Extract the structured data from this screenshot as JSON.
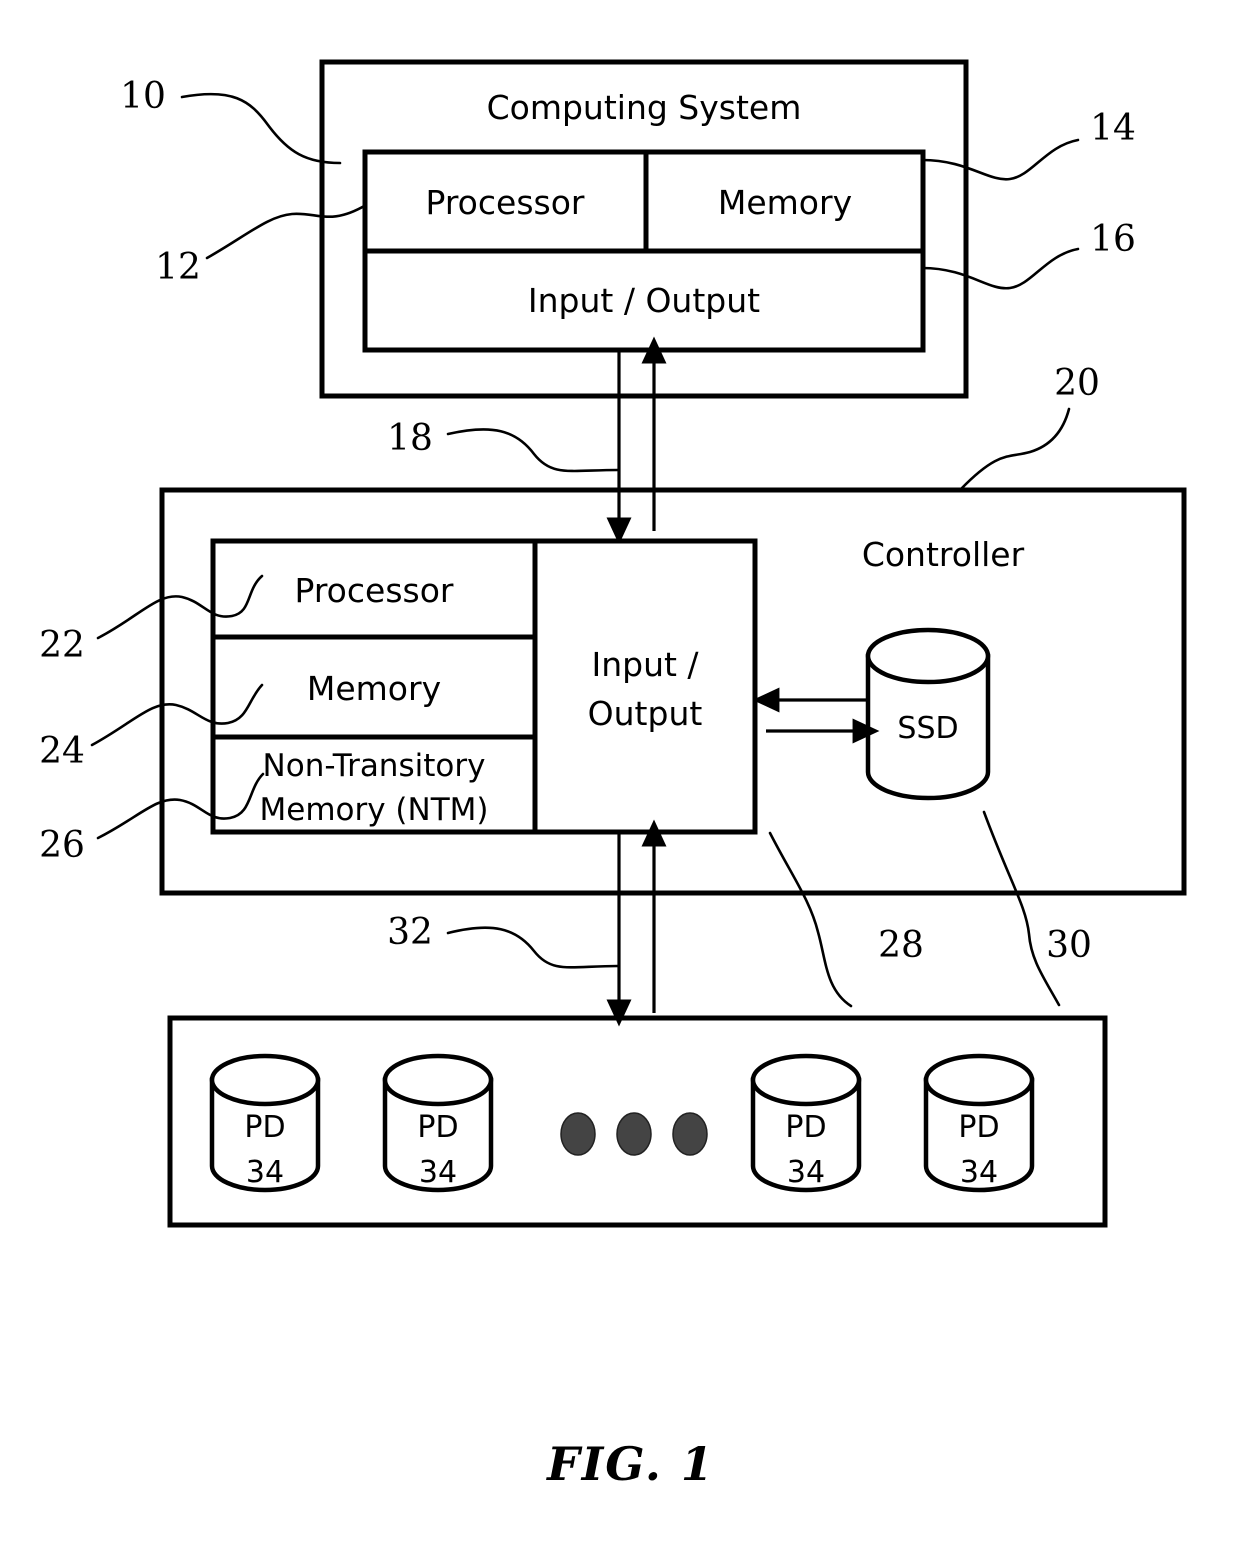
{
  "figure": {
    "caption": "FIG. 1",
    "type": "patent-block-diagram"
  },
  "computing_system": {
    "title": "Computing System",
    "ref": "10",
    "blocks": {
      "processor": {
        "label": "Processor",
        "ref": "12"
      },
      "memory": {
        "label": "Memory",
        "ref": "14"
      },
      "io": {
        "label": "Input / Output",
        "ref": "16"
      }
    }
  },
  "bus_top": {
    "ref": "18"
  },
  "controller": {
    "title": "Controller",
    "ref": "20",
    "blocks": {
      "processor": {
        "label": "Processor",
        "ref": "22"
      },
      "memory": {
        "label": "Memory",
        "ref": "24"
      },
      "ntm_line1": "Non-Transitory",
      "ntm_line2": "Memory (NTM)",
      "ntm_ref": "26",
      "io_line1": "Input /",
      "io_line2": "Output",
      "io_ref": "28"
    },
    "ssd": {
      "label": "SSD",
      "ref": "30"
    }
  },
  "bus_bottom": {
    "ref": "32"
  },
  "disk_array": {
    "disks": [
      {
        "label": "PD",
        "ref": "34"
      },
      {
        "label": "PD",
        "ref": "34"
      },
      {
        "label": "PD",
        "ref": "34"
      },
      {
        "label": "PD",
        "ref": "34"
      }
    ],
    "ellipsis_dots": 3
  },
  "colors": {
    "stroke": "#000000",
    "background": "#ffffff",
    "dot_fill": "#444444"
  }
}
